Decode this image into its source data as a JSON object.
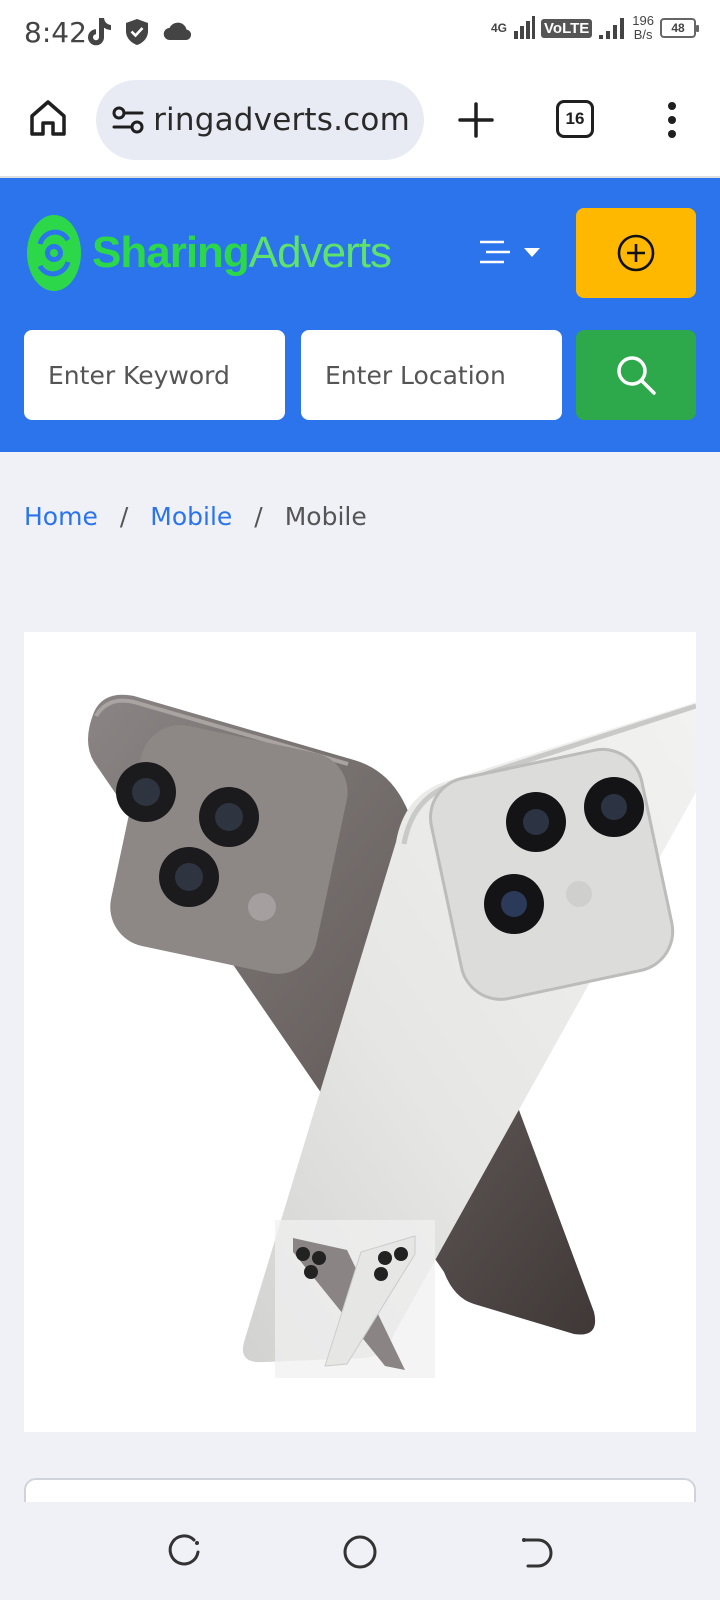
{
  "status_bar": {
    "time": "8:42",
    "network_type": "4G",
    "volte": "VoLTE",
    "speed_value": "196",
    "speed_unit": "B/s",
    "battery": "48"
  },
  "browser": {
    "url": "sharingadverts.com",
    "tab_count": "16"
  },
  "header": {
    "logo_part1": "Sharing",
    "logo_part2": "Adverts",
    "accent_color": "#2b74ec",
    "post_ad_color": "#ffb800",
    "search_color": "#2da84a"
  },
  "search": {
    "keyword_placeholder": "Enter Keyword",
    "location_placeholder": "Enter Location"
  },
  "breadcrumb": {
    "items": [
      "Home",
      "Mobile",
      "Mobile"
    ],
    "separator": "/"
  },
  "icons": {
    "home": "home-icon",
    "site_settings": "tune-icon",
    "new_tab": "plus-icon",
    "menu": "more-vert-icon",
    "nav_toggle": "menu-lines-icon",
    "post_ad": "plus-circle-icon",
    "search": "search-icon",
    "nav_recents": "recents-icon",
    "nav_home": "circle-home-icon",
    "nav_back": "back-icon"
  }
}
